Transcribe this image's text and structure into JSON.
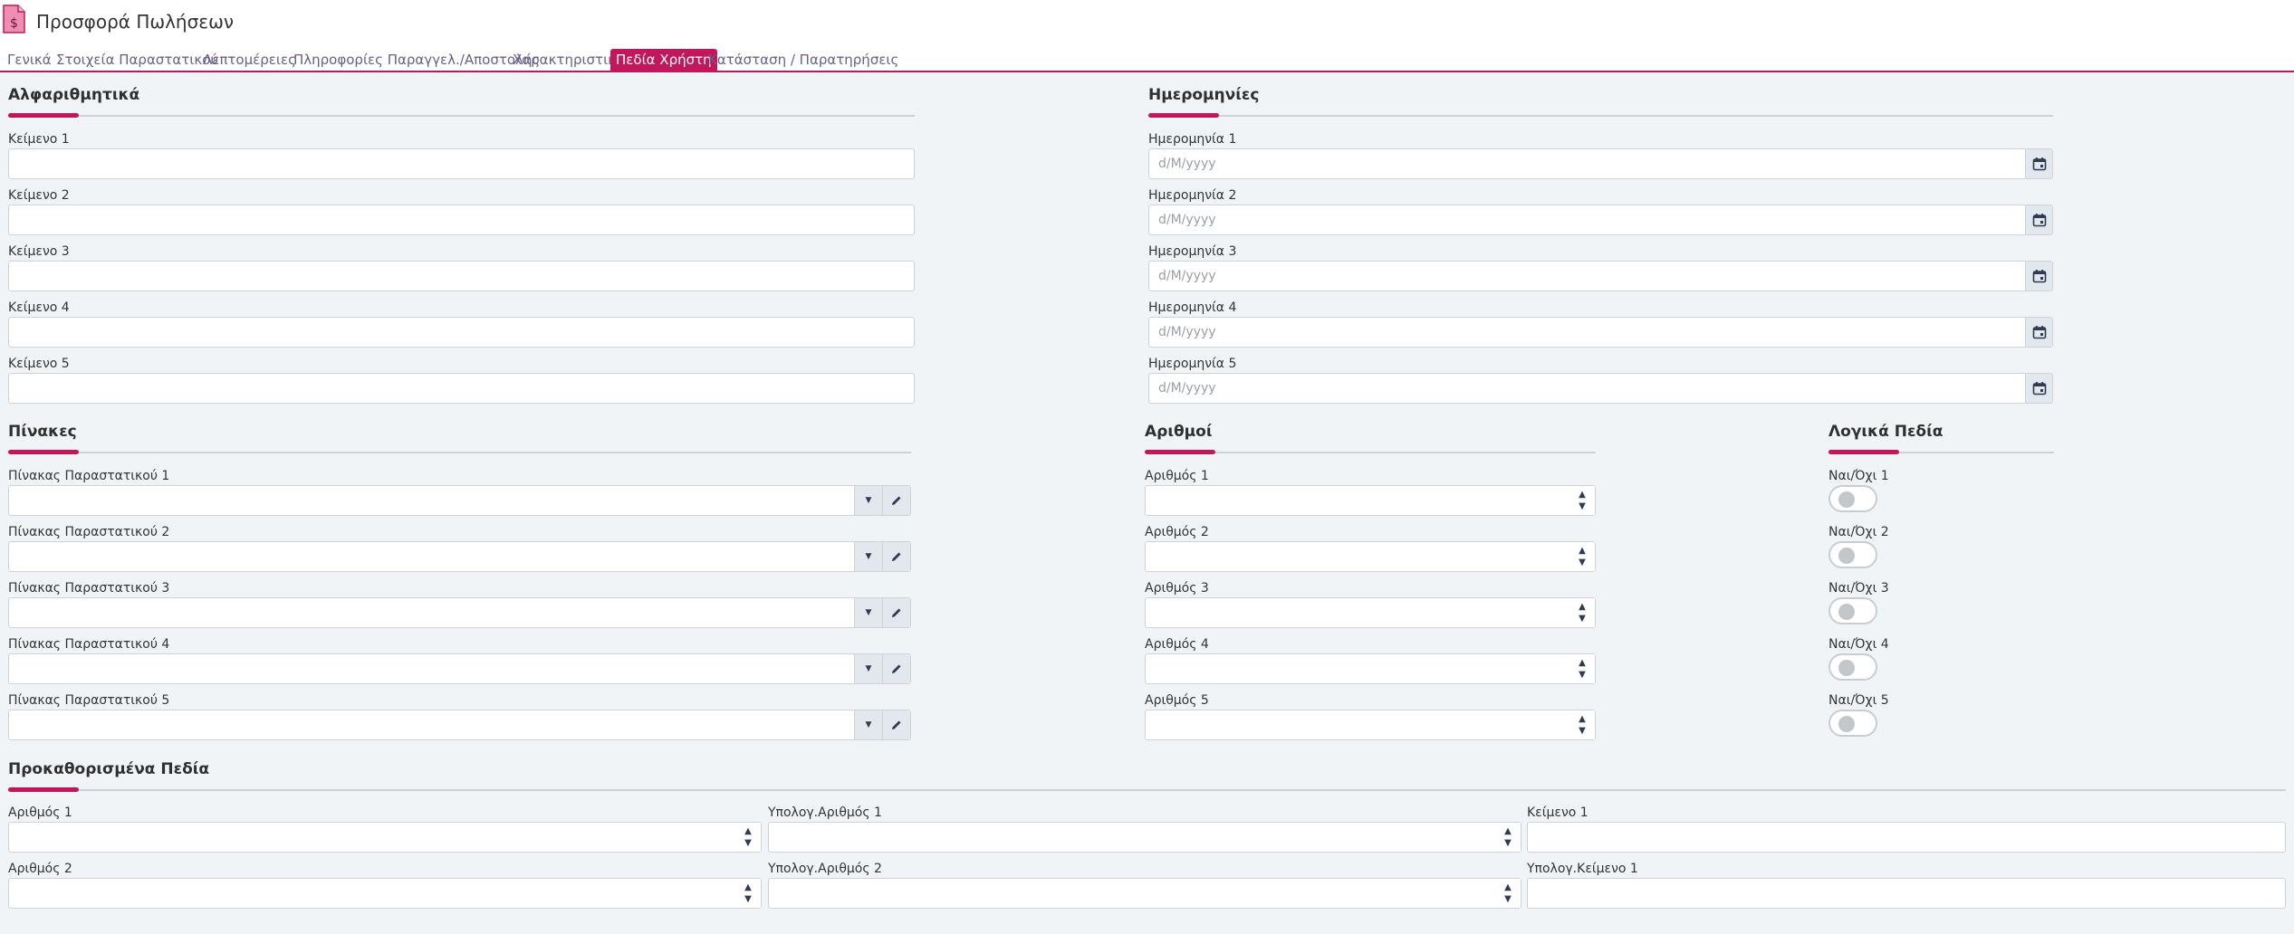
{
  "header": {
    "title": "Προσφορά Πωλήσεων",
    "icon": "sales-document-icon",
    "icon_symbol": "$",
    "accent": "#c2185b"
  },
  "tabs": [
    {
      "label": "Γενικά"
    },
    {
      "label": "Στοιχεία Παραστατικού"
    },
    {
      "label": "Λεπτομέρειες"
    },
    {
      "label": "Πληροφορίες Παραγγελ./Αποστολής"
    },
    {
      "label": "Χαρακτηριστικά"
    },
    {
      "label": "Πεδία Χρήστη",
      "active": true
    },
    {
      "label": "Κατάσταση / Παρατηρήσεις"
    }
  ],
  "alpha": {
    "title": "Αλφαριθμητικά",
    "fields": [
      {
        "label": "Κείμενο 1",
        "value": ""
      },
      {
        "label": "Κείμενο 2",
        "value": ""
      },
      {
        "label": "Κείμενο 3",
        "value": ""
      },
      {
        "label": "Κείμενο 4",
        "value": ""
      },
      {
        "label": "Κείμενο 5",
        "value": ""
      }
    ]
  },
  "dates": {
    "title": "Ημερομηνίες",
    "placeholder": "d/M/yyyy",
    "fields": [
      {
        "label": "Ημερομηνία 1"
      },
      {
        "label": "Ημερομηνία 2"
      },
      {
        "label": "Ημερομηνία 3"
      },
      {
        "label": "Ημερομηνία 4"
      },
      {
        "label": "Ημερομηνία 5"
      }
    ]
  },
  "tables": {
    "title": "Πίνακες",
    "fields": [
      {
        "label": "Πίνακας Παραστατικού 1"
      },
      {
        "label": "Πίνακας Παραστατικού 2"
      },
      {
        "label": "Πίνακας Παραστατικού 3"
      },
      {
        "label": "Πίνακας Παραστατικού 4"
      },
      {
        "label": "Πίνακας Παραστατικού 5"
      }
    ]
  },
  "numbers": {
    "title": "Αριθμοί",
    "fields": [
      {
        "label": "Αριθμός 1"
      },
      {
        "label": "Αριθμός 2"
      },
      {
        "label": "Αριθμός 3"
      },
      {
        "label": "Αριθμός 4"
      },
      {
        "label": "Αριθμός 5"
      }
    ]
  },
  "booleans": {
    "title": "Λογικά Πεδία",
    "fields": [
      {
        "label": "Ναι/Όχι 1",
        "checked": false
      },
      {
        "label": "Ναι/Όχι 2",
        "checked": false
      },
      {
        "label": "Ναι/Όχι 3",
        "checked": false
      },
      {
        "label": "Ναι/Όχι 4",
        "checked": false
      },
      {
        "label": "Ναι/Όχι 5",
        "checked": false
      }
    ]
  },
  "predefined": {
    "title": "Προκαθορισμένα Πεδία",
    "fields": [
      {
        "label": "Αριθμός 1",
        "kind": "number"
      },
      {
        "label": "Υπολογ.Αριθμός 1",
        "kind": "number"
      },
      {
        "label": "Κείμενο 1",
        "kind": "text"
      },
      {
        "label": "Αριθμός 2",
        "kind": "number"
      },
      {
        "label": "Υπολογ.Αριθμός 2",
        "kind": "number"
      },
      {
        "label": "Υπολογ.Κείμενο 1",
        "kind": "text"
      }
    ]
  }
}
